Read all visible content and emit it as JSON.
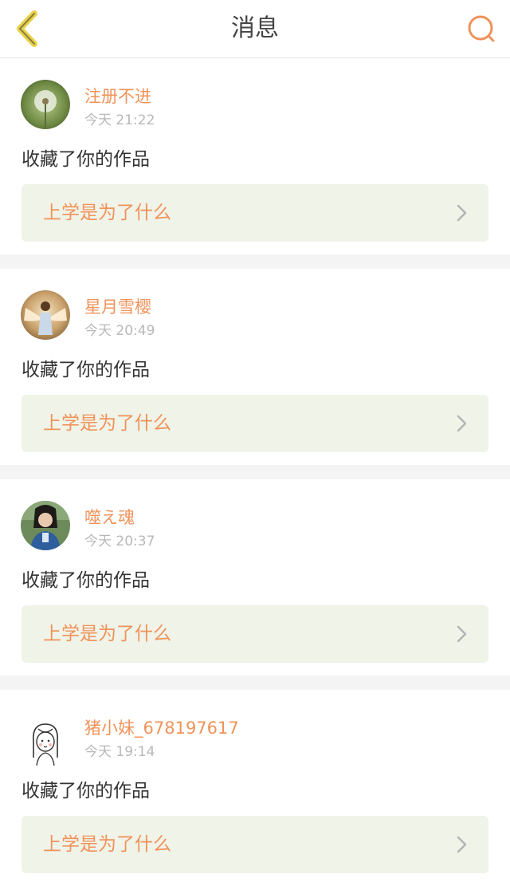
{
  "header": {
    "title": "消息",
    "back_icon": "chevron-left-icon",
    "search_icon": "search-icon",
    "accent_color": "#f0935a",
    "back_color": "#e9d24a"
  },
  "messages": [
    {
      "username": "注册不进",
      "time": "今天 21:22",
      "action": "收藏了你的作品",
      "work_title": "上学是为了什么",
      "avatar": "dandelion-avatar"
    },
    {
      "username": "星月雪樱",
      "time": "今天 20:49",
      "action": "收藏了你的作品",
      "work_title": "上学是为了什么",
      "avatar": "angel-avatar"
    },
    {
      "username": "噬え魂",
      "time": "今天 20:37",
      "action": "收藏了你的作品",
      "work_title": "上学是为了什么",
      "avatar": "girl-photo-avatar"
    },
    {
      "username": "猪小妹_678197617",
      "time": "今天 19:14",
      "action": "收藏了你的作品",
      "work_title": "上学是为了什么",
      "avatar": "line-drawing-girl-avatar"
    }
  ],
  "colors": {
    "username": "#f0935a",
    "time": "#b8b8b8",
    "link_background": "#f0f3e8",
    "separator": "#f4f4f4"
  }
}
